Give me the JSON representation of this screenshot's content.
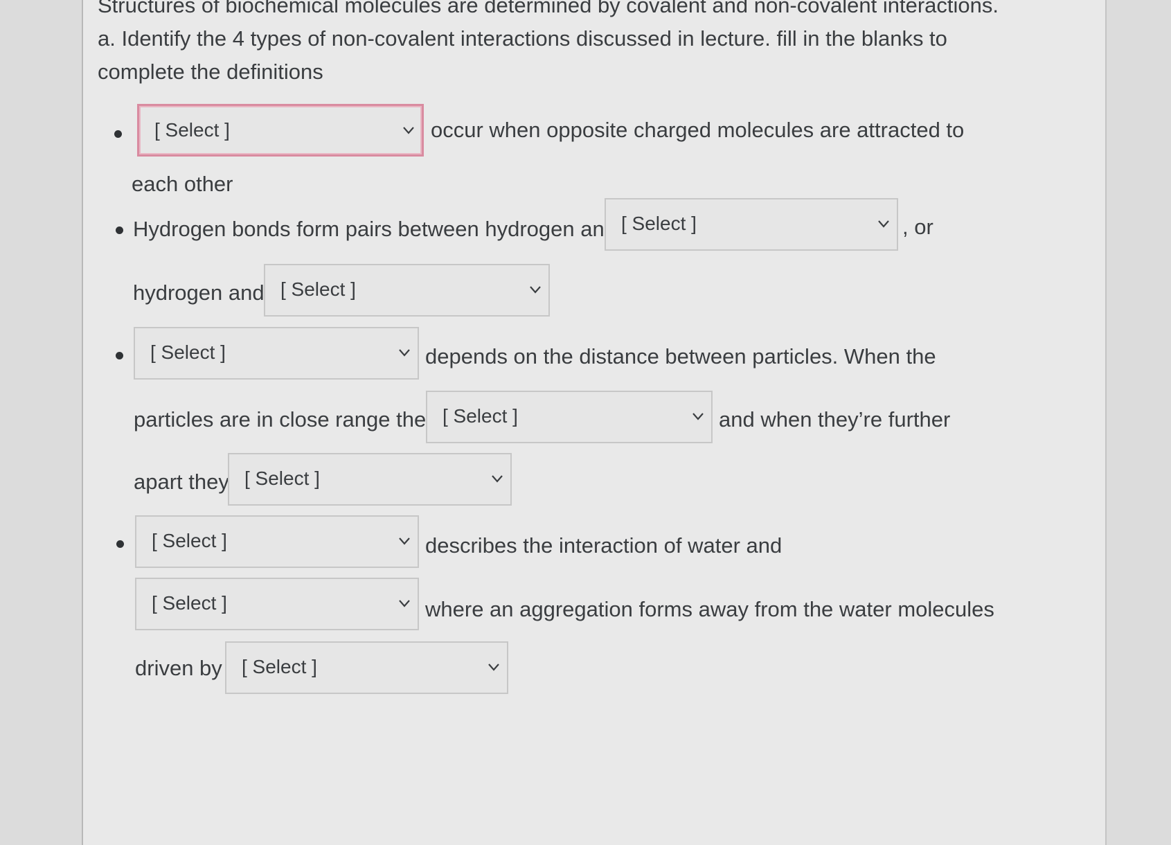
{
  "question": {
    "intro": "Structures of biochemical molecules are determined by covalent and non-covalent interactions.",
    "part_a_line1": "a. Identify the 4 types of non-covalent interactions discussed in lecture.  fill in the blanks to",
    "part_a_line2": "complete the definitions"
  },
  "items": {
    "ionic": {
      "after": "occur when opposite charged molecules are attracted to",
      "cont": "each other"
    },
    "hbond": {
      "before": "Hydrogen bonds form pairs between hydrogen and",
      "after": ", or",
      "line2_before": "hydrogen and"
    },
    "vdw": {
      "after": "depends on the distance between particles. When the",
      "line2_before": "particles are in close range they",
      "line2_after": "and when they’re further",
      "line3_before": "apart they"
    },
    "hydrophobic": {
      "after": "describes the interaction of water and",
      "line2_after": "where an aggregation forms away from the water molecules",
      "line3_before": "driven by"
    }
  },
  "dropdowns": {
    "placeholder": "[ Select ]"
  },
  "colors": {
    "active_border": "#d98ba0",
    "text": "#3a3d40"
  },
  "icons": {
    "dropdown": "chevron-down-icon"
  }
}
